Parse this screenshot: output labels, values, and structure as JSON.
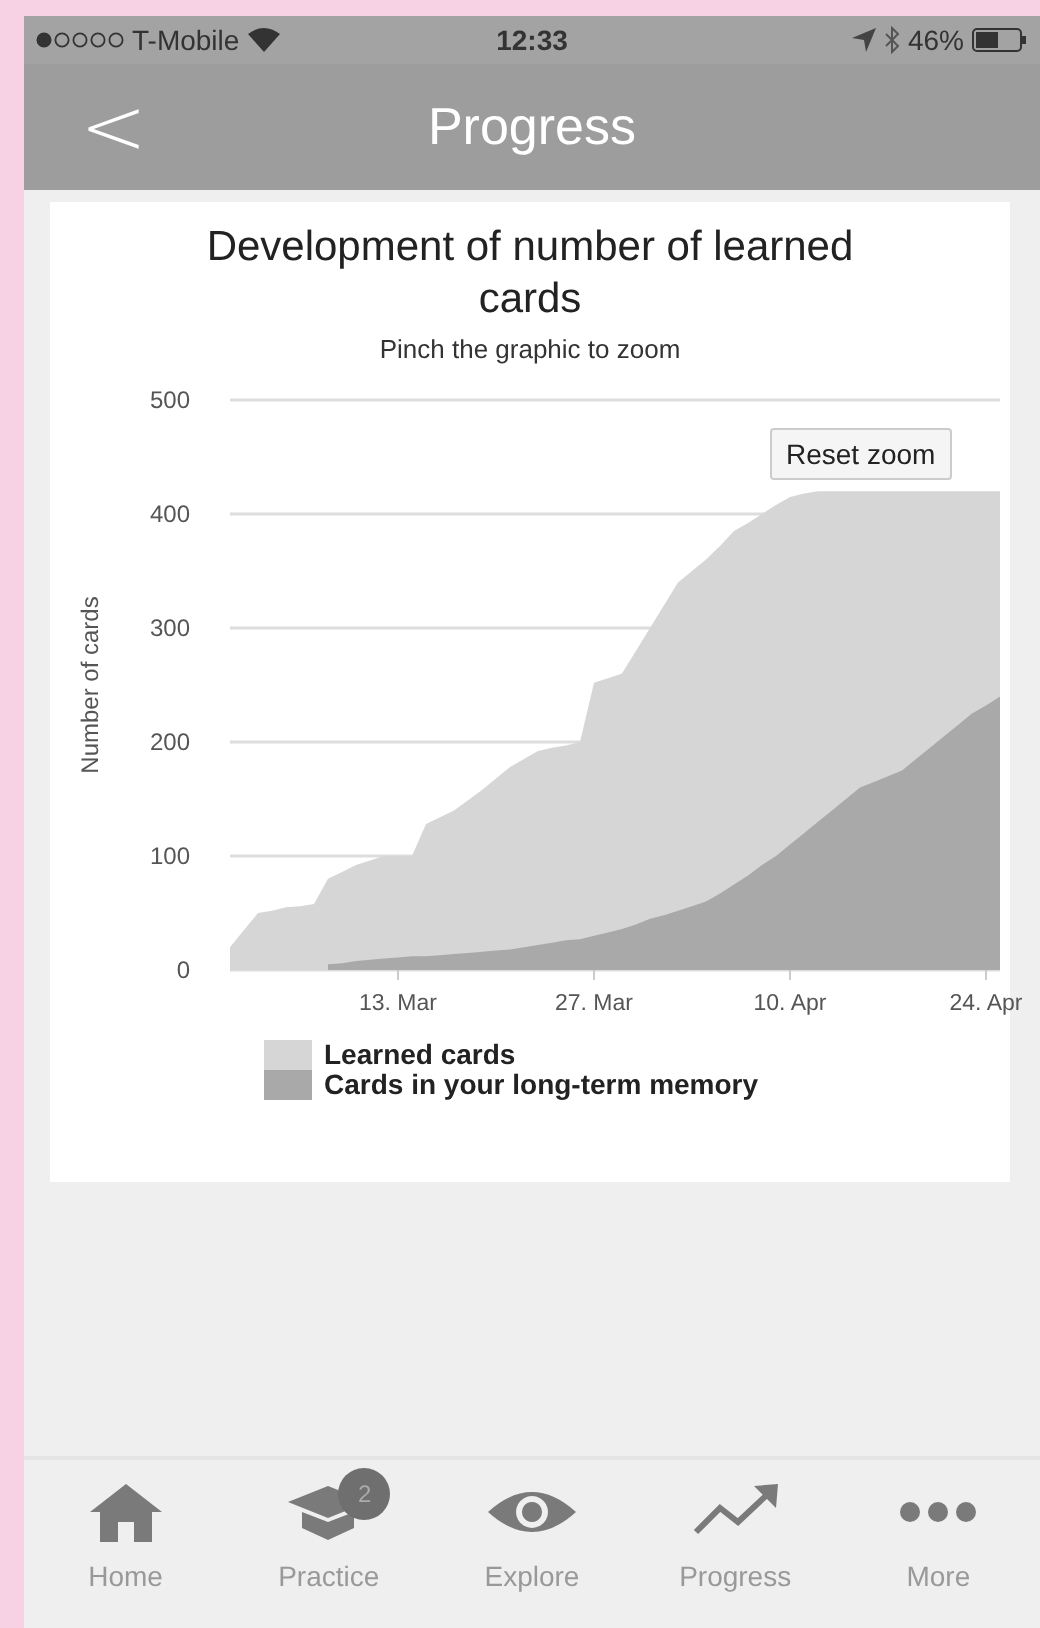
{
  "status_bar": {
    "carrier": "T-Mobile",
    "time": "12:33",
    "battery": "46%"
  },
  "nav_bar": {
    "back": "<",
    "title": "Progress"
  },
  "card": {
    "title": "Development of number of learned cards",
    "subtitle": "Pinch the graphic to zoom",
    "reset_button": "Reset zoom",
    "chart_data": {
      "type": "area",
      "ylabel": "Number of cards",
      "categories": [
        null,
        null,
        null,
        null,
        null,
        null,
        null,
        null,
        null,
        null,
        null,
        null,
        "13. Mar",
        null,
        null,
        null,
        null,
        null,
        null,
        null,
        null,
        null,
        null,
        null,
        null,
        null,
        "27. Mar",
        null,
        null,
        null,
        null,
        null,
        null,
        null,
        null,
        null,
        null,
        null,
        null,
        null,
        "10. Apr",
        null,
        null,
        null,
        null,
        null,
        null,
        null,
        null,
        null,
        null,
        null,
        null,
        null,
        "24. Apr",
        null
      ],
      "series": [
        {
          "name": "Learned cards",
          "color": "#d6d6d6",
          "values": [
            20,
            35,
            50,
            52,
            55,
            56,
            58,
            80,
            86,
            92,
            96,
            100,
            100,
            100,
            128,
            134,
            140,
            149,
            158,
            168,
            178,
            185,
            192,
            195,
            197,
            200,
            252,
            256,
            260,
            280,
            300,
            320,
            340,
            350,
            360,
            372,
            385,
            392,
            400,
            408,
            415,
            418,
            420,
            420,
            420,
            420,
            420,
            420,
            420,
            420,
            420,
            420,
            420,
            420,
            420,
            420
          ]
        },
        {
          "name": "Cards in your long-term memory",
          "color": "#a9a9a9",
          "values": [
            null,
            null,
            null,
            null,
            null,
            null,
            null,
            5,
            6,
            8,
            9,
            10,
            11,
            12,
            12,
            13,
            14,
            15,
            16,
            17,
            18,
            20,
            22,
            24,
            26,
            27,
            30,
            33,
            36,
            40,
            45,
            48,
            52,
            56,
            60,
            67,
            75,
            83,
            92,
            100,
            110,
            120,
            130,
            140,
            150,
            160,
            165,
            170,
            175,
            185,
            195,
            205,
            215,
            225,
            232,
            240
          ]
        }
      ],
      "ylim": [
        0,
        500
      ],
      "yticks": [
        0,
        100,
        200,
        300,
        400,
        500
      ],
      "stacked": false,
      "grid": true
    }
  },
  "tab_bar": [
    {
      "kind": "home",
      "label": "Home"
    },
    {
      "kind": "practice",
      "label": "Practice",
      "badge": "2"
    },
    {
      "kind": "explore",
      "label": "Explore"
    },
    {
      "kind": "progress",
      "label": "Progress"
    },
    {
      "kind": "more",
      "label": "More"
    }
  ]
}
